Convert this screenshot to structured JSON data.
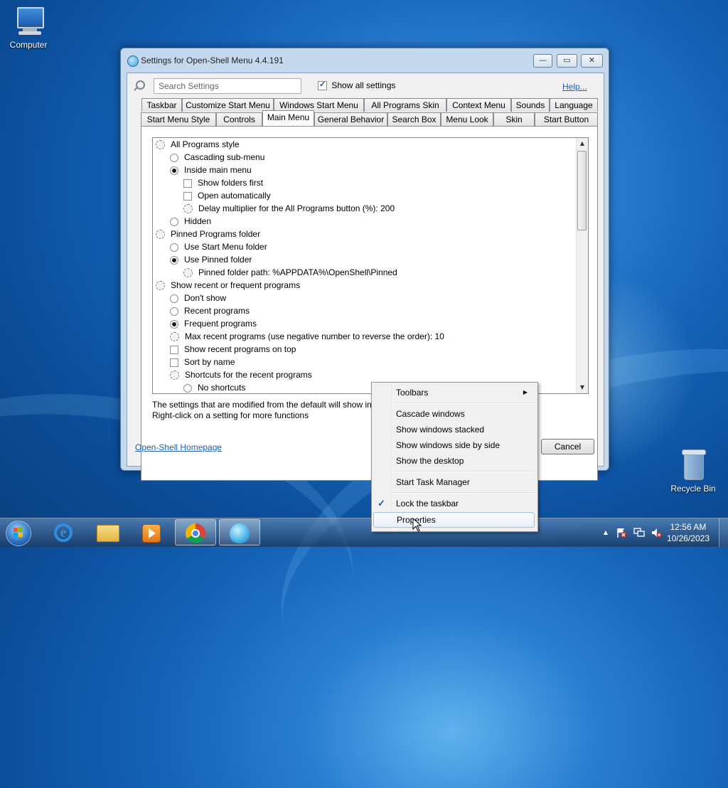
{
  "desktop": {
    "computer_label": "Computer",
    "recycle_label": "Recycle Bin"
  },
  "window": {
    "title": "Settings for Open-Shell Menu 4.4.191",
    "minimize": "—",
    "maximize": "▭",
    "close": "✕",
    "search_placeholder": "Search Settings",
    "show_all_label": "Show all settings",
    "show_all_checked": true,
    "help_link": "Help...",
    "tabs_row1": [
      "Taskbar",
      "Customize Start Menu",
      "Windows Start Menu",
      "All Programs Skin",
      "Context Menu",
      "Sounds",
      "Language"
    ],
    "tabs_row2": [
      "Start Menu Style",
      "Controls",
      "Main Menu",
      "General Behavior",
      "Search Box",
      "Menu Look",
      "Skin",
      "Start Button"
    ],
    "selected_tab": "Main Menu",
    "settings": [
      {
        "type": "group",
        "label": "All Programs style"
      },
      {
        "type": "radio",
        "label": "Cascading sub-menu",
        "checked": false
      },
      {
        "type": "radio",
        "label": "Inside main menu",
        "checked": true
      },
      {
        "type": "check",
        "label": "Show folders first",
        "checked": false
      },
      {
        "type": "check",
        "label": "Open automatically",
        "checked": false
      },
      {
        "type": "value",
        "label": "Delay multiplier for the All Programs button (%): 200"
      },
      {
        "type": "radio",
        "label": "Hidden",
        "checked": false
      },
      {
        "type": "group",
        "label": "Pinned Programs folder"
      },
      {
        "type": "radio",
        "label": "Use Start Menu folder",
        "checked": false
      },
      {
        "type": "radio",
        "label": "Use Pinned folder",
        "checked": true
      },
      {
        "type": "value",
        "label": "Pinned folder path: %APPDATA%\\OpenShell\\Pinned"
      },
      {
        "type": "group",
        "label": "Show recent or frequent programs"
      },
      {
        "type": "radio",
        "label": "Don't show",
        "checked": false
      },
      {
        "type": "radio",
        "label": "Recent programs",
        "checked": false
      },
      {
        "type": "radio",
        "label": "Frequent programs",
        "checked": true
      },
      {
        "type": "value",
        "label": "Max recent programs (use negative number to reverse the order): 10"
      },
      {
        "type": "check",
        "label": "Show recent programs on top",
        "checked": false
      },
      {
        "type": "check",
        "label": "Sort by name",
        "checked": false
      },
      {
        "type": "value",
        "label": "Shortcuts for the recent programs"
      },
      {
        "type": "radio",
        "label": "No shortcuts",
        "checked": false
      }
    ],
    "hint_line1": "The settings that are modified from the default will show in b",
    "hint_line2": "Right-click on a setting for more functions",
    "homepage_link": "Open-Shell Homepage",
    "cancel_label": "Cancel"
  },
  "context_menu": {
    "items": [
      "Toolbars",
      "Cascade windows",
      "Show windows stacked",
      "Show windows side by side",
      "Show the desktop",
      "Start Task Manager",
      "Lock the taskbar",
      "Properties"
    ],
    "submenu_arrow": "▶",
    "check_mark": "✓",
    "lock_checked": true,
    "highlighted": "Properties"
  },
  "taskbar": {
    "time": "12:56 AM",
    "date": "10/26/2023",
    "tray_arrow": "▲",
    "apps": [
      "start-orb",
      "internet-explorer",
      "file-explorer",
      "media-player",
      "chrome",
      "open-shell"
    ]
  }
}
